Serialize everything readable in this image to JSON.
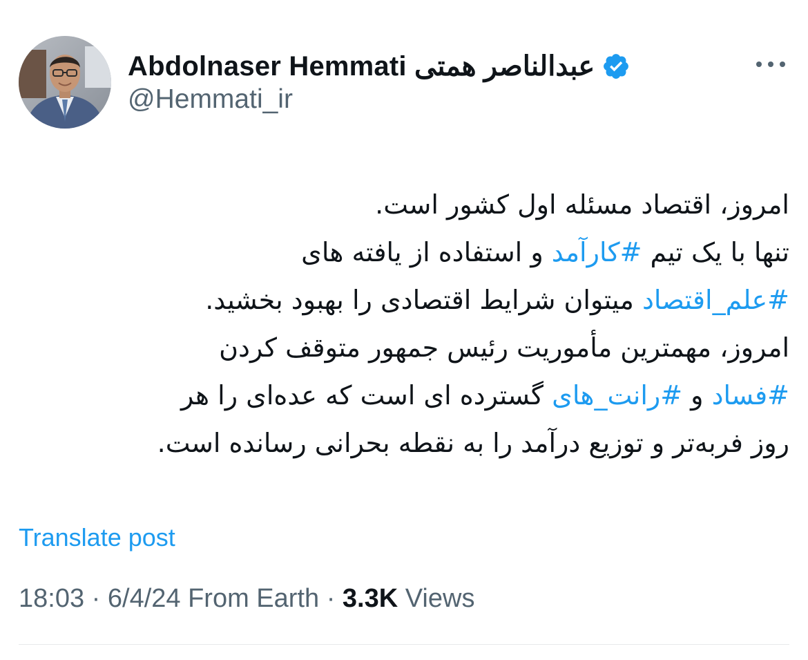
{
  "author": {
    "display_name": "Abdolnaser Hemmati عبدالناصر همتی",
    "handle": "@Hemmati_ir",
    "verified_icon": "verified-badge-icon",
    "more_icon": "more-options-icon"
  },
  "post": {
    "lines": [
      [
        {
          "text": "امروز، اقتصاد مسئله اول کشور است.",
          "hashtag": false
        }
      ],
      [
        {
          "text": "تنها با یک تیم ",
          "hashtag": false
        },
        {
          "text": "#کارآمد",
          "hashtag": true
        },
        {
          "text": " و استفاده از یافته های",
          "hashtag": false
        }
      ],
      [
        {
          "text": "#علم_اقتصاد",
          "hashtag": true
        },
        {
          "text": " میتوان شرایط اقتصادی را بهبود بخشید.",
          "hashtag": false
        }
      ],
      [
        {
          "text": "امروز، مهمترین مأموریت رئیس جمهور متوقف کردن",
          "hashtag": false
        }
      ],
      [
        {
          "text": "#فساد",
          "hashtag": true
        },
        {
          "text": " و ",
          "hashtag": false
        },
        {
          "text": "#رانت_های",
          "hashtag": true
        },
        {
          "text": " گسترده ای است که عده‌ای را هر",
          "hashtag": false
        }
      ],
      [
        {
          "text": "روز فربه‌تر و توزیع درآمد را به نقطه بحرانی رسانده است.",
          "hashtag": false
        }
      ]
    ],
    "translate_label": "Translate post",
    "time": "18:03",
    "date": "6/4/24",
    "source": "From Earth",
    "views_count": "3.3K",
    "views_label": "Views",
    "separator": "·"
  },
  "colors": {
    "accent": "#1d9bf0",
    "text": "#0f1419",
    "secondary": "#536471"
  }
}
